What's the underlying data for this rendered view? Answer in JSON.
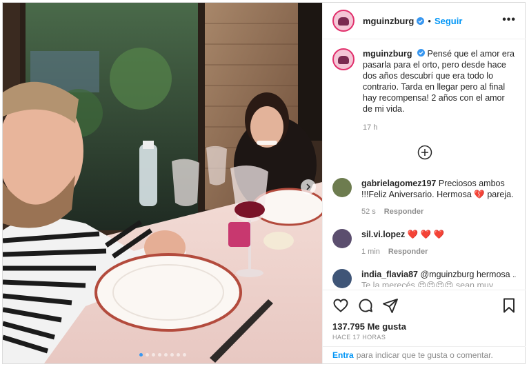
{
  "post": {
    "username": "mguinzburg",
    "follow_label": "Seguir",
    "separator": "•",
    "more_label": "•••",
    "caption": "Pensé que el amor era pasarla para el orto, pero desde hace dos años descubrí que era todo lo contrario. Tarda en llegar pero al final hay recompensa! 2 años con el amor de mi vida.",
    "time_ago": "17 h",
    "likes": "137.795 Me gusta",
    "posted_ago": "HACE 17 HORAS",
    "carousel_dots": 8,
    "active_dot": 0
  },
  "comments": [
    {
      "username": "gabrielagomez197",
      "text_1": "Preciosos ambos !!!Feliz Aniversario. Hermosa",
      "heart": "💔",
      "text_2": "pareja.",
      "time": "52 s",
      "reply": "Responder"
    },
    {
      "username": "sil.vi.lopez",
      "hearts": "❤️ ❤️ ❤️",
      "time": "1 min",
      "reply": "Responder"
    },
    {
      "username": "india_flavia87",
      "text_1": "@mguinzburg hermosa ...",
      "text_2": "Te la merecés 😍😍😍😍 sean muy"
    }
  ],
  "login_bar": {
    "enter": "Entra",
    "rest": "para indicar que te gusta o comentar."
  },
  "colors": {
    "accent": "#0095f6",
    "text": "#262626",
    "muted": "#8e8e8e",
    "verified": "#3897f0"
  },
  "icons": [
    "verified-badge-icon",
    "more-options-icon",
    "carousel-next-icon",
    "load-more-comments-icon",
    "heart-icon",
    "comment-icon",
    "share-icon",
    "bookmark-icon"
  ]
}
